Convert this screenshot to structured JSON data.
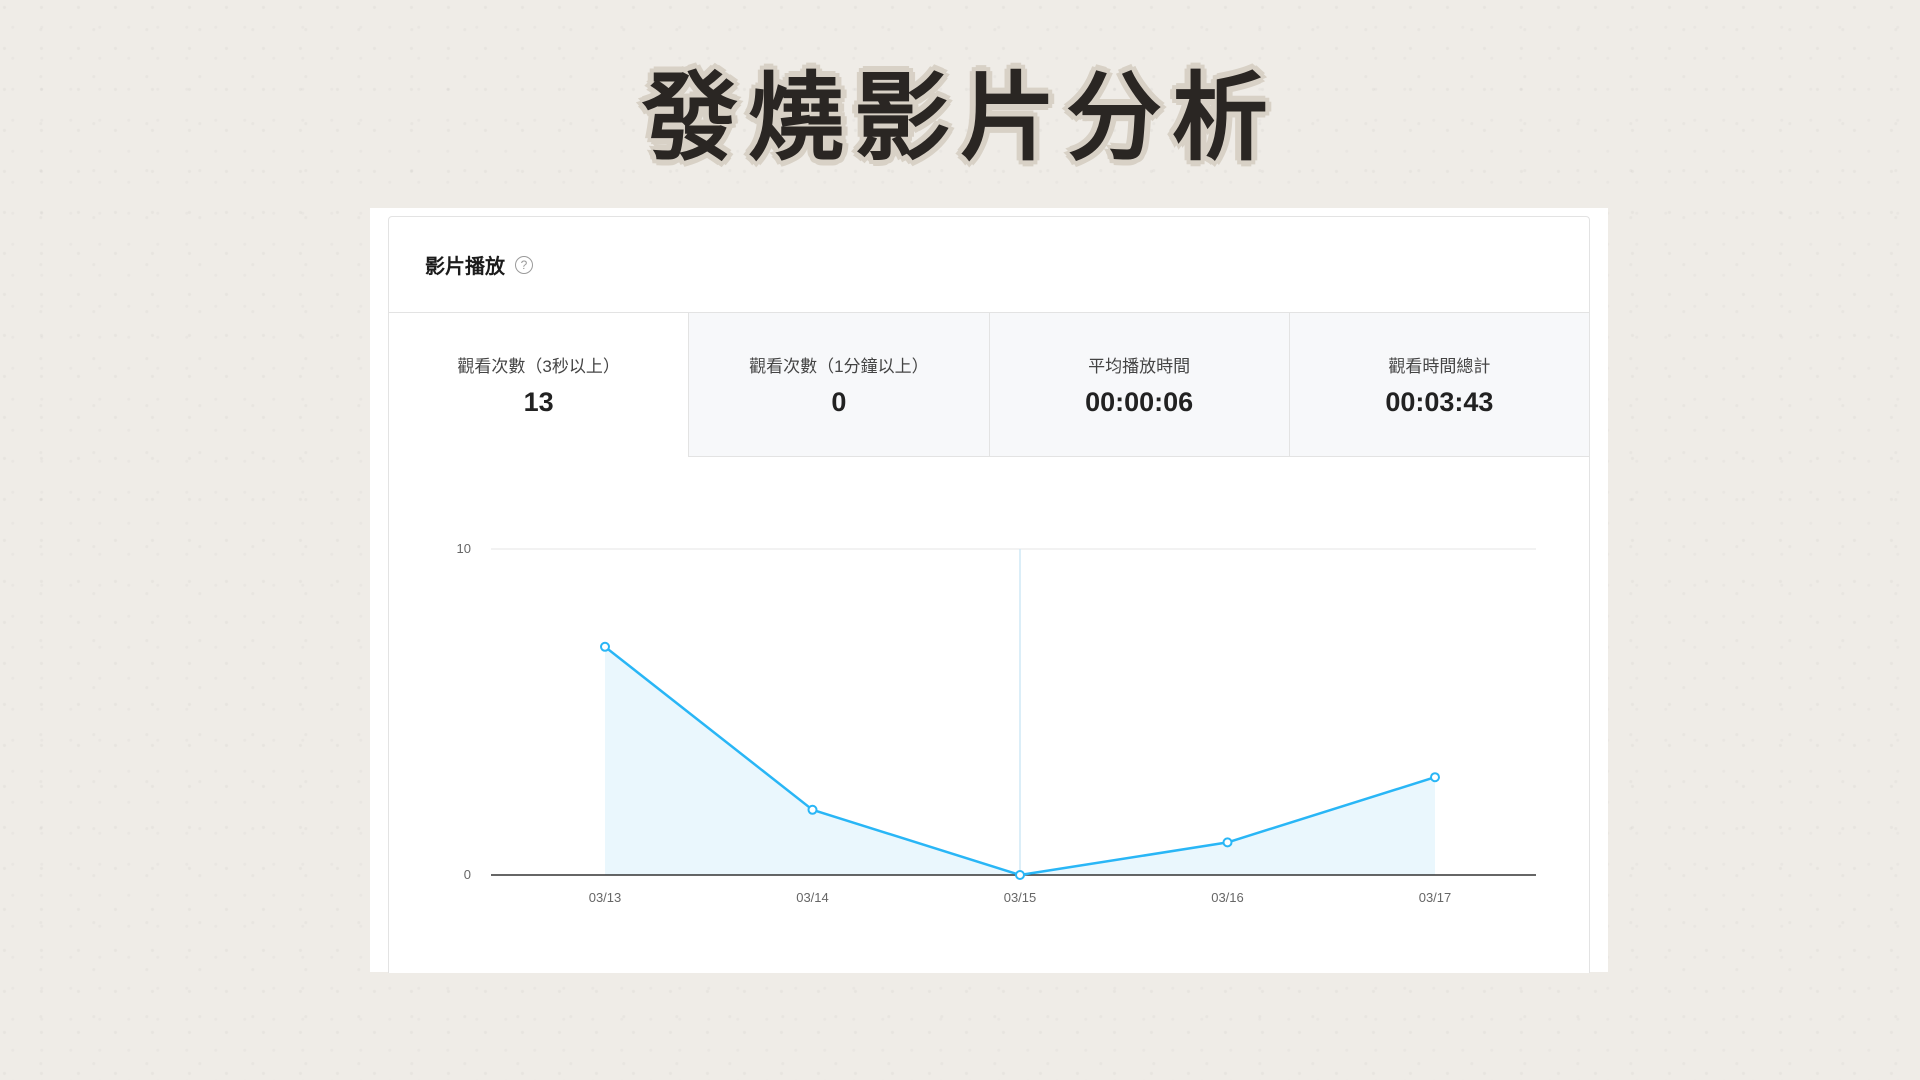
{
  "title": "發燒影片分析",
  "panel": {
    "title": "影片播放",
    "help_icon": "question-circle-icon"
  },
  "tabs": [
    {
      "label": "觀看次數（3秒以上）",
      "value": "13",
      "active": true
    },
    {
      "label": "觀看次數（1分鐘以上）",
      "value": "0",
      "active": false
    },
    {
      "label": "平均播放時間",
      "value": "00:00:06",
      "active": false
    },
    {
      "label": "觀看時間總計",
      "value": "00:03:43",
      "active": false
    }
  ],
  "colors": {
    "line": "#29b6f6",
    "fill": "#eaf7fd",
    "cursor": "#cfe8f5",
    "axis": "#333333",
    "grid": "#e6e6e6"
  },
  "chart_data": {
    "type": "area",
    "categories": [
      "03/13",
      "03/14",
      "03/15",
      "03/16",
      "03/17"
    ],
    "values": [
      7,
      2,
      0,
      1,
      3
    ],
    "ylim": [
      0,
      10
    ],
    "yticks": [
      "0",
      "10"
    ],
    "hover_index": 2,
    "grid": true,
    "legend": "none"
  }
}
